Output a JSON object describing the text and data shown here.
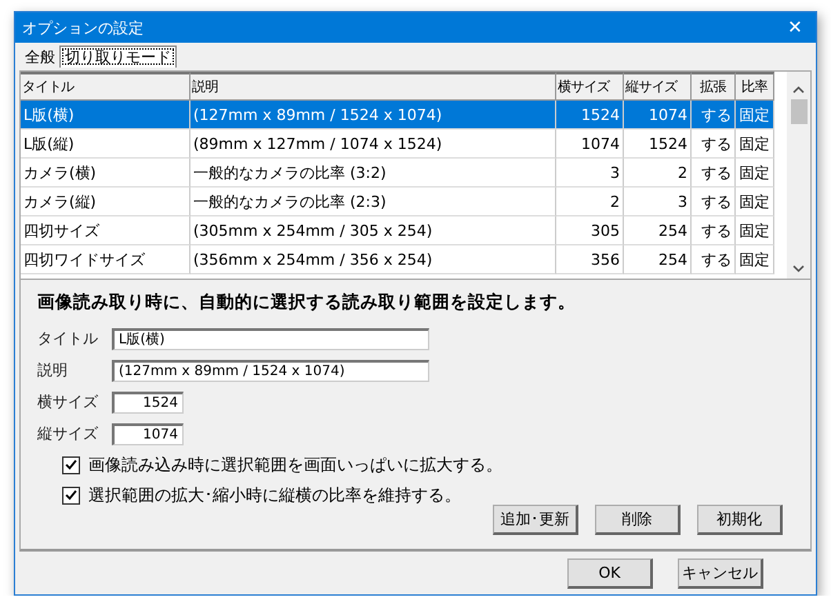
{
  "window": {
    "title": "オプションの設定",
    "close": "✕"
  },
  "tabs": [
    {
      "label": "全般",
      "selected": false
    },
    {
      "label": "切り取りモード",
      "selected": true
    }
  ],
  "table": {
    "columns": [
      "タイトル",
      "説明",
      "横サイズ",
      "縦サイズ",
      "拡張",
      "比率"
    ],
    "rows": [
      {
        "selected": true,
        "cells": [
          "L版(横)",
          "(127mm x 89mm / 1524 x 1074)",
          "1524",
          "1074",
          "する",
          "固定"
        ]
      },
      {
        "selected": false,
        "cells": [
          "L版(縦)",
          "(89mm x 127mm / 1074 x 1524)",
          "1074",
          "1524",
          "する",
          "固定"
        ]
      },
      {
        "selected": false,
        "cells": [
          "カメラ(横)",
          "一般的なカメラの比率 (3:2)",
          "3",
          "2",
          "する",
          "固定"
        ]
      },
      {
        "selected": false,
        "cells": [
          "カメラ(縦)",
          "一般的なカメラの比率 (2:3)",
          "2",
          "3",
          "する",
          "固定"
        ]
      },
      {
        "selected": false,
        "cells": [
          "四切サイズ",
          "(305mm x 254mm / 305 x 254)",
          "305",
          "254",
          "する",
          "固定"
        ]
      },
      {
        "selected": false,
        "cells": [
          "四切ワイドサイズ",
          "(356mm x 254mm / 356 x 254)",
          "356",
          "254",
          "する",
          "固定"
        ]
      }
    ]
  },
  "form": {
    "heading": "画像読み取り時に、自動的に選択する読み取り範囲を設定します。",
    "fields": [
      {
        "label": "タイトル",
        "value": "L版(横)",
        "kind": "wide"
      },
      {
        "label": "説明",
        "value": "(127mm x 89mm / 1524 x 1074)",
        "kind": "wide"
      },
      {
        "label": "横サイズ",
        "value": "1524",
        "kind": "number"
      },
      {
        "label": "縦サイズ",
        "value": "1074",
        "kind": "number"
      }
    ],
    "checkboxes": [
      {
        "label": "画像読み込み時に選択範囲を画面いっぱいに拡大する。",
        "checked": true
      },
      {
        "label": "選択範囲の拡大･縮小時に縦横の比率を維持する。",
        "checked": true
      }
    ],
    "buttons": [
      "追加･更新",
      "削除",
      "初期化"
    ]
  },
  "footer_buttons": [
    "OK",
    "キャンセル"
  ]
}
